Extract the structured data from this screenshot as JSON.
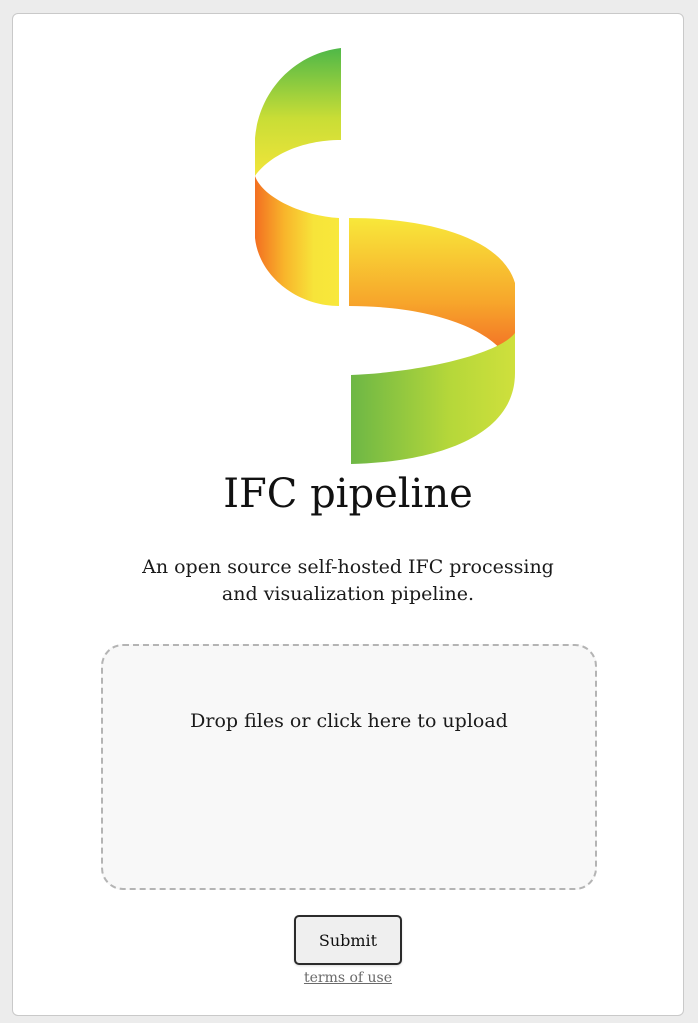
{
  "app": {
    "title": "IFC pipeline",
    "description": "An open source self-hosted IFC processing and visualization pipeline."
  },
  "logo": {
    "icon": "s-ribbon-logo",
    "colors": [
      "#4fb848",
      "#c4dc38",
      "#f7e83a",
      "#f7a72a",
      "#f15a24"
    ]
  },
  "upload": {
    "label": "Drop files or click here to upload"
  },
  "form": {
    "submit_label": "Submit",
    "terms_label": "terms of use"
  }
}
